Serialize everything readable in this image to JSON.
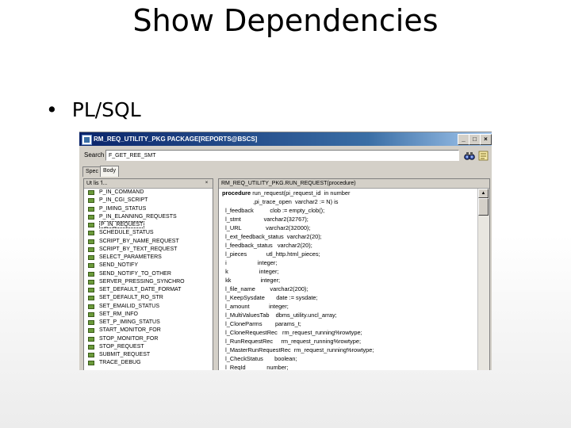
{
  "slide": {
    "title": "Show Dependencies",
    "bullet_marker": "•",
    "bullet_text": "PL/SQL"
  },
  "window": {
    "title": "RM_REQ_UTILITY_PKG  PACKAGE[REPORTS@BSCS]",
    "min_label": "_",
    "max_label": "□",
    "close_label": "×"
  },
  "search": {
    "label": "Search",
    "value": "F_GET_REE_SMT"
  },
  "toolbar": {
    "find_icon": "binoculars-icon",
    "props_icon": "properties-icon"
  },
  "tabs": [
    {
      "label": "Spec"
    },
    {
      "label": "Body"
    }
  ],
  "left_pane": {
    "header": "Ut lis 'l...",
    "items": [
      {
        "label": "P_IN_COMMAND"
      },
      {
        "label": "P_IN_CGI_SCRIPT"
      },
      {
        "label": "P_IMING_STATUS"
      },
      {
        "label": "P_IN_ELANNING_REQUESTS"
      },
      {
        "label": "P_IN_REQUEST",
        "selected": true
      },
      {
        "label": "SCHEDULE_STATUS"
      },
      {
        "label": "SCRIPT_BY_NAME_REQUEST"
      },
      {
        "label": "SCRIPT_BY_TEXT_REQUEST"
      },
      {
        "label": "SELECT_PARAMETERS"
      },
      {
        "label": "SEND_NOTIFY"
      },
      {
        "label": "SEND_NOTIFY_TO_OTHER"
      },
      {
        "label": "SERVER_PRESSING_SYNCHRO"
      },
      {
        "label": "SET_DEFAULT_DATE_FORMAT"
      },
      {
        "label": "SET_DEFAULT_RO_STR"
      },
      {
        "label": "SET_EMAILID_STATUS"
      },
      {
        "label": "SET_RM_INFO"
      },
      {
        "label": "SET_P_IMING_STATUS"
      },
      {
        "label": "START_MONITOR_FOR"
      },
      {
        "label": "STOP_MONITOR_FOR"
      },
      {
        "label": "STOP_REQUEST"
      },
      {
        "label": "SUBMIT_REQUEST"
      },
      {
        "label": "TRACE_DEBUG"
      }
    ]
  },
  "right_pane": {
    "header": "RM_REQ_UTILITY_PKG.RUN_REQUEST(procedure)",
    "lines": [
      {
        "kw": "procedure",
        "rest": " run_request(pi_request_id  in number"
      },
      {
        "kw": "",
        "rest": "                   ,pi_trace_open  varchar2 := N) is"
      },
      {
        "kw": "",
        "rest": "  l_feedback          clob := empty_clob();"
      },
      {
        "kw": "",
        "rest": "  l_stmt              varchar2(32767);"
      },
      {
        "kw": "",
        "rest": "  l_URL               varchar2(32000);"
      },
      {
        "kw": "",
        "rest": "  l_ext_feedback_status  varchar2(20);"
      },
      {
        "kw": "",
        "rest": "  l_feedback_status   varchar2(20);"
      },
      {
        "kw": "",
        "rest": "  l_pieces            utl_http.html_pieces;"
      },
      {
        "kw": "",
        "rest": "  i                   integer;"
      },
      {
        "kw": "",
        "rest": "  k                   integer;"
      },
      {
        "kw": "",
        "rest": "  kk                  integer;"
      },
      {
        "kw": "",
        "rest": "  l_file_name         varchar2(200);"
      },
      {
        "kw": "",
        "rest": "  l_KeepSysdate       date := sysdate;"
      },
      {
        "kw": "",
        "rest": "  l_amount            integer;"
      },
      {
        "kw": "",
        "rest": "  l_MultiValuesTab    dbms_utility.uncl_array;"
      },
      {
        "kw": "",
        "rest": "  l_CloneParms        params_t;"
      },
      {
        "kw": "",
        "rest": "  l_CloneRequestRec   rm_request_running%rowtype;"
      },
      {
        "kw": "",
        "rest": "  l_RunRequestRec     rm_request_running%rowtype;"
      },
      {
        "kw": "",
        "rest": "  l_MasterRunRequestRec  rm_request_running%rowtype;"
      },
      {
        "kw": "",
        "rest": "  l_CheckStatus       boolean;"
      },
      {
        "kw": "",
        "rest": "  l_ReqId             number;"
      }
    ]
  }
}
